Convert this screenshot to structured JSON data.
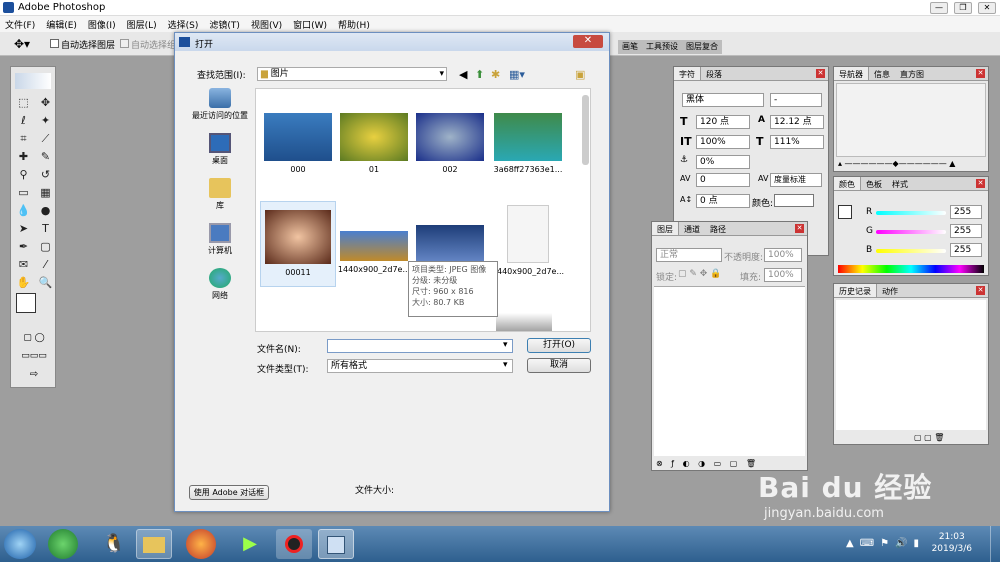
{
  "app": {
    "title": "Adobe Photoshop"
  },
  "menu": [
    "文件(F)",
    "编辑(E)",
    "图像(I)",
    "图层(L)",
    "选择(S)",
    "滤镜(T)",
    "视图(V)",
    "窗口(W)",
    "帮助(H)"
  ],
  "options": {
    "auto_select_layer": "自动选择图层",
    "auto_select_group": "自动选择组",
    "palette_tabs": [
      "画笔",
      "工具预设",
      "图层复合"
    ]
  },
  "dialog": {
    "title": "打开",
    "lookin_label": "查找范围(I):",
    "lookin_value": "图片",
    "places": [
      "最近访问的位置",
      "桌面",
      "库",
      "计算机",
      "网络"
    ],
    "files": [
      "000",
      "01",
      "002",
      "3a68ff27363e1...",
      "00011",
      "1440x900_2d7e...",
      "1440x900_2d7e..."
    ],
    "tooltip": {
      "type": "项目类型: JPEG 图像",
      "rating": "分级: 未分级",
      "dims": "尺寸: 960 x 816",
      "size": "大小: 80.7 KB"
    },
    "filename_label": "文件名(N):",
    "filename_value": "",
    "filetype_label": "文件类型(T):",
    "filetype_value": "所有格式",
    "open_button": "打开(O)",
    "cancel_button": "取消",
    "adobe_dialog_button": "使用 Adobe 对话框",
    "filesize_label": "文件大小:"
  },
  "character_panel": {
    "tabs": [
      "字符",
      "段落"
    ],
    "font": "黑体",
    "font_style": "-",
    "size": "120 点",
    "leading": "12.12 点",
    "vscale": "100%",
    "hscale": "111%",
    "tracking_pct": "0%",
    "kerning": "0",
    "kerning_mode": "度量标准",
    "baseline": "0 点",
    "color_label": "颜色:"
  },
  "layers_panel": {
    "tabs": [
      "图层",
      "通道",
      "路径"
    ],
    "blend": "正常",
    "opacity_label": "不透明度:",
    "opacity": "100%",
    "lock_label": "锁定:",
    "fill_label": "填充:",
    "fill": "100%"
  },
  "navigator_panel": {
    "tabs": [
      "导航器",
      "信息",
      "直方图"
    ]
  },
  "color_panel": {
    "tabs": [
      "颜色",
      "色板",
      "样式"
    ],
    "r_label": "R",
    "r": "255",
    "g_label": "G",
    "g": "255",
    "b_label": "B",
    "b": "255"
  },
  "history_panel": {
    "tabs": [
      "历史记录",
      "动作"
    ]
  },
  "taskbar": {
    "time": "21:03",
    "date": "2019/3/6"
  },
  "watermark": {
    "brand": "Bai du 经验",
    "url": "jingyan.baidu.com"
  },
  "colors": {
    "workspace": "#9e9e9e",
    "dialog_border": "#6c8fbf",
    "taskbar": "#2e5f8e"
  }
}
